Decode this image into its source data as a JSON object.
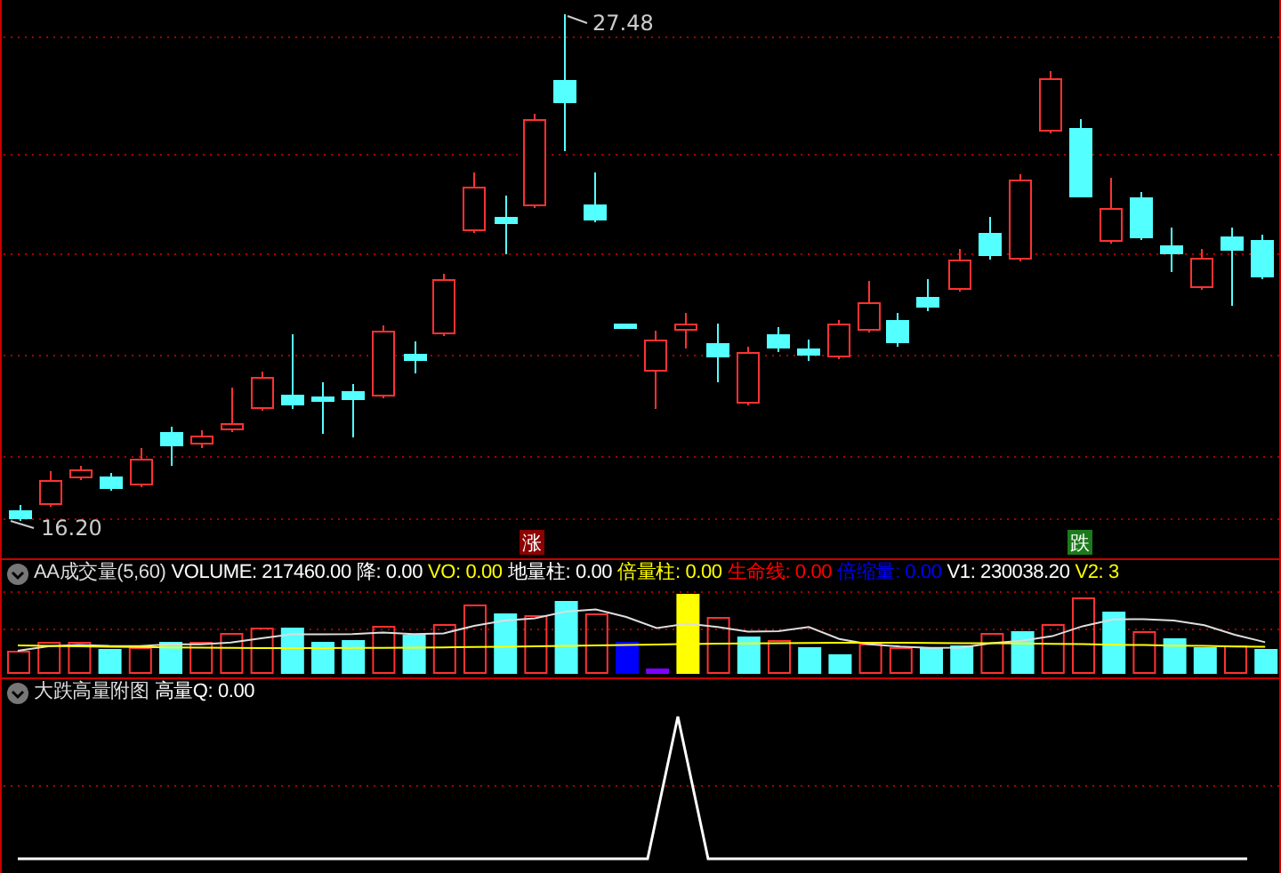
{
  "price_panel": {
    "high_label": "27.48",
    "low_label": "16.20",
    "signals": [
      {
        "text": "涨",
        "kind": "rise"
      },
      {
        "text": "跌",
        "kind": "fall"
      }
    ]
  },
  "volume_panel": {
    "title": "AA成交量(5,60)",
    "readouts": [
      {
        "text": "VOLUME: 217460.00",
        "color": "#ffffff"
      },
      {
        "text": "降: 0.00",
        "color": "#ffffff"
      },
      {
        "text": "VO: 0.00",
        "color": "#ffff00"
      },
      {
        "text": "地量柱: 0.00",
        "color": "#ffffff"
      },
      {
        "text": "倍量柱: 0.00",
        "color": "#ffff00"
      },
      {
        "text": "生命线: 0.00",
        "color": "#ff0000"
      },
      {
        "text": "倍缩量: 0.00",
        "color": "#0000ff"
      },
      {
        "text": "V1: 230038.20",
        "color": "#ffffff"
      },
      {
        "text": "V2: 3",
        "color": "#ffff00"
      }
    ]
  },
  "indicator_panel": {
    "title": "大跌高量附图",
    "readouts": [
      {
        "text": "高量Q: 0.00",
        "color": "#ffffff"
      }
    ]
  }
}
